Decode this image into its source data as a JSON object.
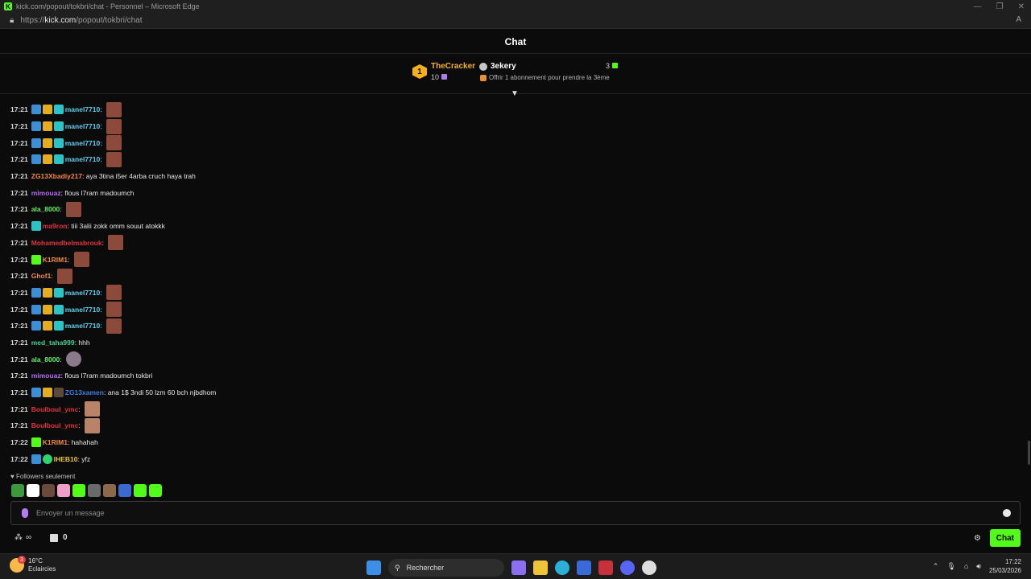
{
  "window": {
    "title": "kick.com/popout/tokbri/chat - Personnel – Microsoft Edge",
    "url_prefix": "https://",
    "url_host": "kick.com",
    "url_path": "/popout/tokbri/chat"
  },
  "chat_title": "Chat",
  "pinned": {
    "rank": "1",
    "top_gifter": "TheCracker",
    "top_gifter_count": "10",
    "second": "3ekery",
    "second_count": "3",
    "offer_text": "Offrir 1 abonnement pour prendre la 3ème"
  },
  "messages": [
    {
      "time": "17:21",
      "badges": [
        "b-blue",
        "b-crown",
        "b-teal"
      ],
      "user": "manel7710",
      "color": "#5ad2ef",
      "text": "",
      "emote": "red"
    },
    {
      "time": "17:21",
      "badges": [
        "b-blue",
        "b-crown",
        "b-teal"
      ],
      "user": "manel7710",
      "color": "#5ad2ef",
      "text": "",
      "emote": "red"
    },
    {
      "time": "17:21",
      "badges": [
        "b-blue",
        "b-crown",
        "b-teal"
      ],
      "user": "manel7710",
      "color": "#5ad2ef",
      "text": "",
      "emote": "red"
    },
    {
      "time": "17:21",
      "badges": [
        "b-blue",
        "b-crown",
        "b-teal"
      ],
      "user": "manel7710",
      "color": "#5ad2ef",
      "text": "",
      "emote": "red"
    },
    {
      "time": "17:21",
      "badges": [],
      "user": "ZG13Xbadiy217",
      "color": "#f08a3a",
      "text": "aya 3tina i5er 4arba cruch haya trah",
      "emote": ""
    },
    {
      "time": "17:21",
      "badges": [],
      "user": "mimouaz",
      "color": "#b46cf0",
      "text": "flous l7ram madoumch",
      "emote": ""
    },
    {
      "time": "17:21",
      "badges": [],
      "user": "ala_8000",
      "color": "#5ef05e",
      "text": "",
      "emote": "red"
    },
    {
      "time": "17:21",
      "badges": [
        "b-teal"
      ],
      "user": "ma9ron",
      "color": "#e0323c",
      "text": "tiii 3alii zokk omm souut atokkk",
      "emote": ""
    },
    {
      "time": "17:21",
      "badges": [],
      "user": "Mohamedbelmabrouk",
      "color": "#e0323c",
      "text": "",
      "emote": "red"
    },
    {
      "time": "17:21",
      "badges": [
        "b-green"
      ],
      "user": "K1RIM1",
      "color": "#f08a3a",
      "text": "",
      "emote": "red"
    },
    {
      "time": "17:21",
      "badges": [],
      "user": "Ghof1",
      "color": "#f08a3a",
      "text": "",
      "emote": "red"
    },
    {
      "time": "17:21",
      "badges": [
        "b-blue",
        "b-crown",
        "b-teal"
      ],
      "user": "manel7710",
      "color": "#5ad2ef",
      "text": "",
      "emote": "red"
    },
    {
      "time": "17:21",
      "badges": [
        "b-blue",
        "b-crown",
        "b-teal"
      ],
      "user": "manel7710",
      "color": "#5ad2ef",
      "text": "",
      "emote": "red"
    },
    {
      "time": "17:21",
      "badges": [
        "b-blue",
        "b-crown",
        "b-teal"
      ],
      "user": "manel7710",
      "color": "#5ad2ef",
      "text": "",
      "emote": "red"
    },
    {
      "time": "17:21",
      "badges": [],
      "user": "med_taha999",
      "color": "#3fd08f",
      "text": "hhh",
      "emote": ""
    },
    {
      "time": "17:21",
      "badges": [],
      "user": "ala_8000",
      "color": "#5ef05e",
      "text": "",
      "emote": "gray"
    },
    {
      "time": "17:21",
      "badges": [],
      "user": "mimouaz",
      "color": "#b46cf0",
      "text": "flous l7ram madoumch tokbri",
      "emote": ""
    },
    {
      "time": "17:21",
      "badges": [
        "b-blue",
        "b-crown",
        "b-avatar"
      ],
      "user": "ZG13xamen",
      "color": "#3a7fe0",
      "text": "ana 1$ 3ndi 50 lzm 60 bch njbdhom",
      "emote": ""
    },
    {
      "time": "17:21",
      "badges": [],
      "user": "Boulboul_ymc",
      "color": "#e0323c",
      "text": "",
      "emote": "beige"
    },
    {
      "time": "17:21",
      "badges": [],
      "user": "Boulboul_ymc",
      "color": "#e0323c",
      "text": "",
      "emote": "beige"
    },
    {
      "time": "17:22",
      "badges": [
        "b-green"
      ],
      "user": "K1RIM1",
      "color": "#f08a3a",
      "text": "hahahah",
      "emote": ""
    },
    {
      "time": "17:22",
      "badges": [
        "b-blue",
        "b-verified"
      ],
      "user": "IHEB10",
      "color": "#f0c23a",
      "text": "yfz",
      "emote": ""
    }
  ],
  "followers_only": "Followers seulement",
  "emote_bar_colors": [
    "#3c9a3c",
    "#ffffff",
    "#6a4a3a",
    "#f0a0c8",
    "#53fc18",
    "#6a6a6a",
    "#8a6a4a",
    "#3a6ad0",
    "#53fc18",
    "#53fc18"
  ],
  "input": {
    "placeholder": "Envoyer un message"
  },
  "bottom": {
    "points": "∞",
    "store_count": "0",
    "chat_button": "Chat"
  },
  "taskbar": {
    "temp": "16°C",
    "weather": "Eclaircies",
    "weather_badge": "3",
    "search": "Rechercher",
    "time": "17:22",
    "date": "25/03/2026"
  }
}
